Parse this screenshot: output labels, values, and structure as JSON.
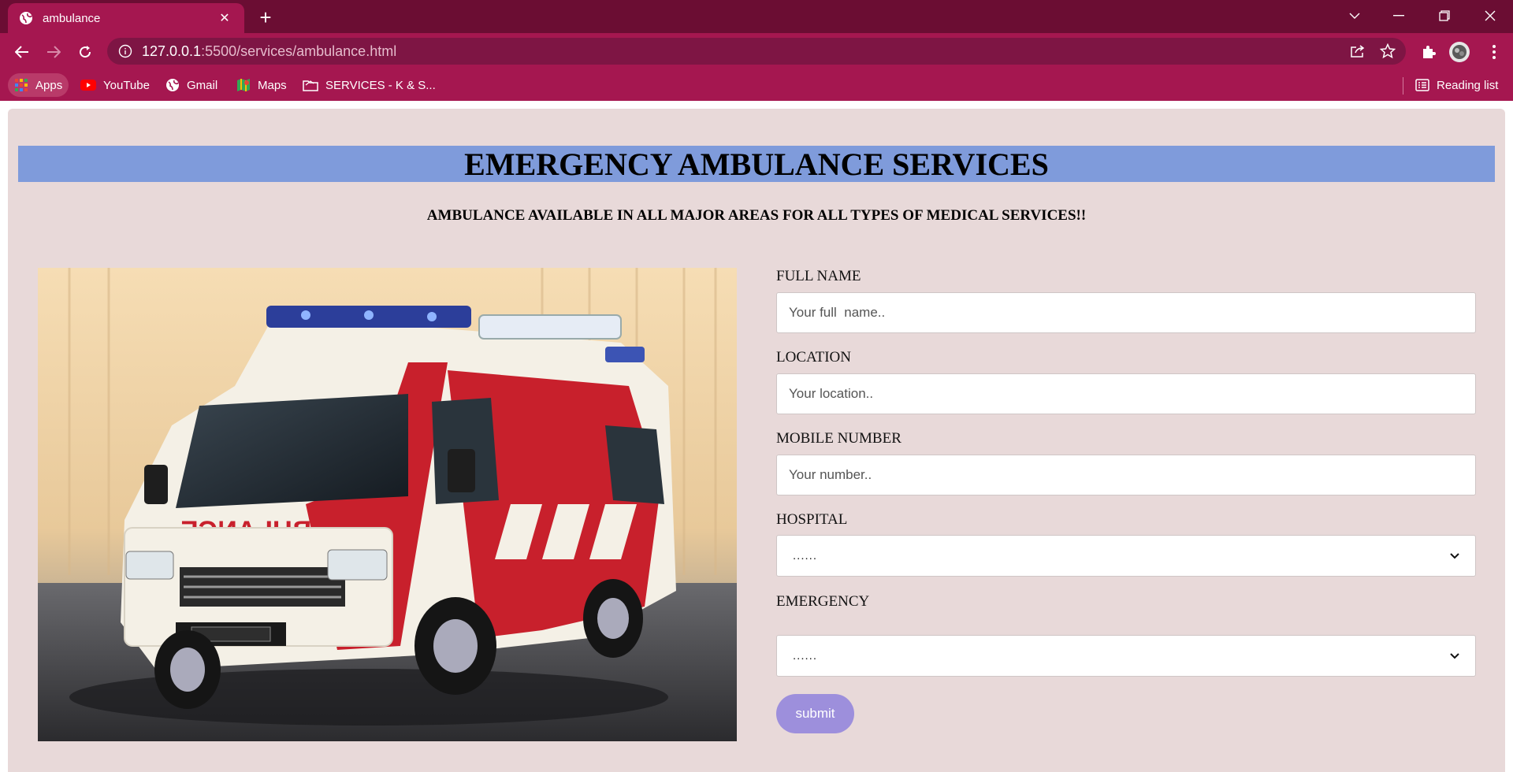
{
  "browser": {
    "tab_title": "ambulance",
    "url_host": "127.0.0.1",
    "url_path": ":5500/services/ambulance.html",
    "bookmarks": [
      {
        "label": "Apps"
      },
      {
        "label": "YouTube"
      },
      {
        "label": "Gmail"
      },
      {
        "label": "Maps"
      },
      {
        "label": "SERVICES - K & S..."
      }
    ],
    "reading_list": "Reading list",
    "colors": {
      "tabbar": "#6b0d33",
      "toolbar": "#a51750",
      "omnibox": "#7e1544"
    }
  },
  "page": {
    "title": "EMERGENCY AMBULANCE SERVICES",
    "subtitle": "AMBULANCE AVAILABLE IN ALL MAJOR AREAS FOR ALL TYPES OF MEDICAL SERVICES!!",
    "colors": {
      "background": "#e8d9d9",
      "banner": "#7f9bdb",
      "submit": "#9d8fdc"
    },
    "form": {
      "full_name_label": "FULL NAME",
      "full_name_placeholder": "Your full  name..",
      "location_label": "LOCATION",
      "location_placeholder": "Your location..",
      "mobile_label": "MOBILE NUMBER",
      "mobile_placeholder": "Your number..",
      "hospital_label": "HOSPITAL",
      "hospital_selected": "......",
      "emergency_label": "EMERGENCY",
      "emergency_selected": "......",
      "submit_label": "submit"
    }
  }
}
